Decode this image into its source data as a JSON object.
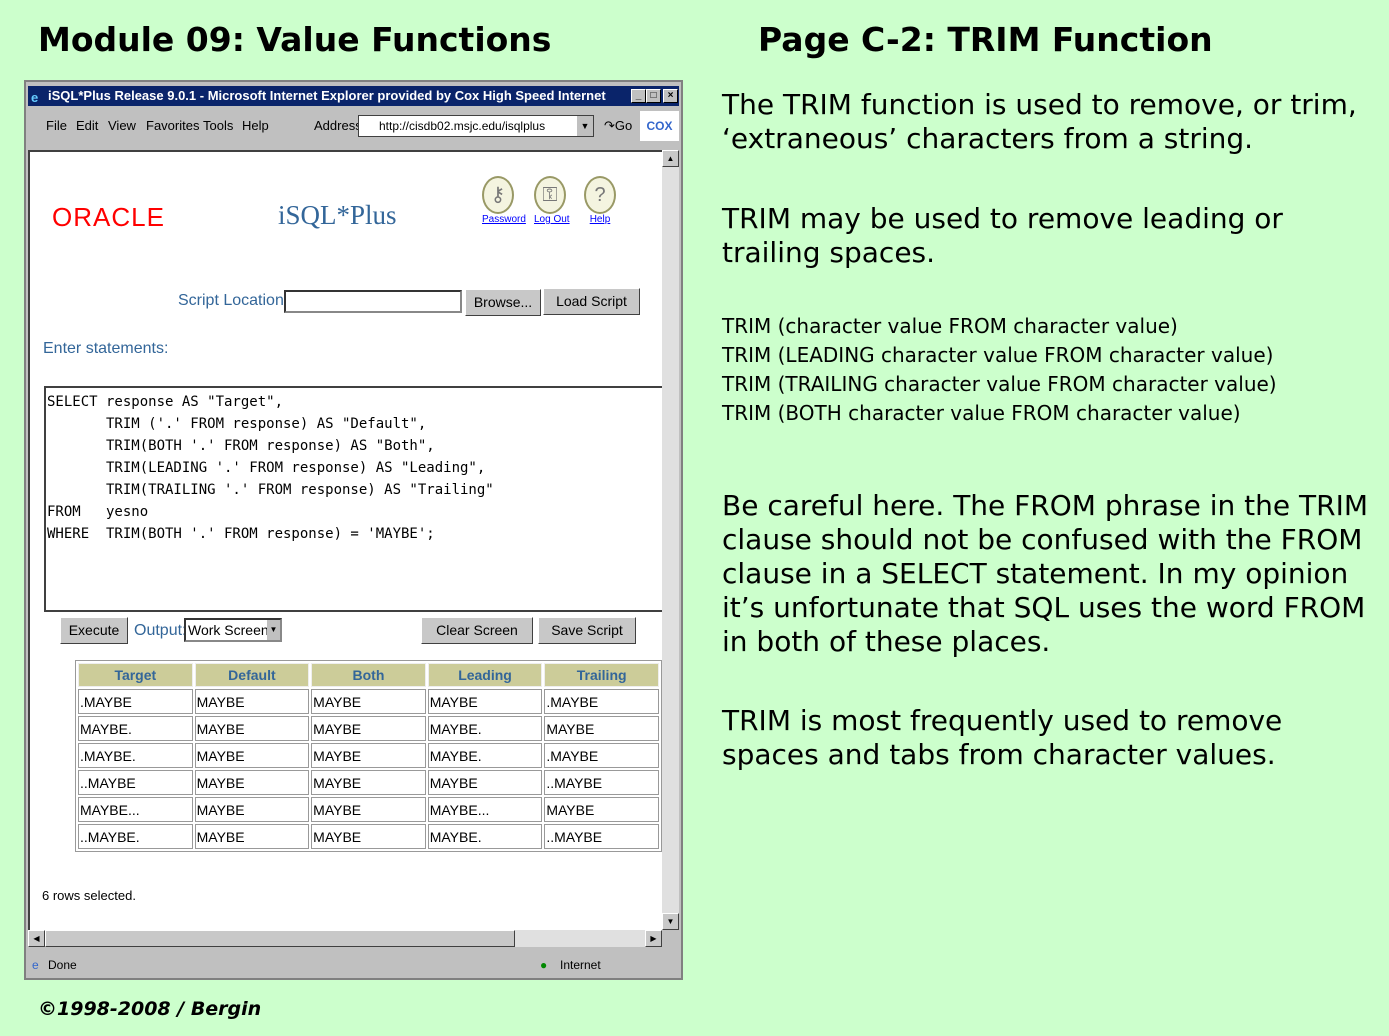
{
  "slide": {
    "left_title": "Module 09: Value Functions",
    "right_title": "Page C-2:  TRIM Function",
    "copyright": "©1998-2008 / Bergin",
    "paragraphs": [
      "The TRIM function is used to remove, or trim, ‘extraneous’ characters from a string.",
      "TRIM may be used to remove leading or trailing spaces.",
      "Be careful here.  The FROM phrase in the TRIM clause should not be confused with the FROM clause in a SELECT statement.  In my opinion it’s unfortunate that SQL uses the word FROM in both of these places.",
      "TRIM is most frequently used to remove spaces and tabs from character values."
    ],
    "syntax": [
      "TRIM (character value  FROM  character value)",
      "TRIM (LEADING character value  FROM  character value)",
      "TRIM (TRAILING character value  FROM  character value)",
      "TRIM (BOTH character value  FROM  character value)"
    ]
  },
  "browser": {
    "title": "iSQL*Plus Release 9.0.1 - Microsoft Internet Explorer provided by Cox High Speed Internet",
    "menu": [
      "File",
      "Edit",
      "View",
      "Favorites",
      "Tools",
      "Help"
    ],
    "address_label": "Address",
    "address": "http://cisdb02.msjc.edu/isqlplus",
    "go": "Go",
    "brand": "COX",
    "status": "Done",
    "zone": "Internet"
  },
  "app": {
    "logo": "ORACLE",
    "product": "iSQL*Plus",
    "links": [
      {
        "label": "Password",
        "icon": "password-icon"
      },
      {
        "label": "Log Out",
        "icon": "logout-icon"
      },
      {
        "label": "Help",
        "icon": "help-icon"
      }
    ],
    "script_location_label": "Script Location:",
    "script_location_value": "",
    "browse": "Browse...",
    "load_script": "Load Script",
    "enter_statements": "Enter statements:",
    "sql": "SELECT response AS \"Target\",\n       TRIM ('.' FROM response) AS \"Default\",\n       TRIM(BOTH '.' FROM response) AS \"Both\",\n       TRIM(LEADING '.' FROM response) AS \"Leading\",\n       TRIM(TRAILING '.' FROM response) AS \"Trailing\"\nFROM   yesno\nWHERE  TRIM(BOTH '.' FROM response) = 'MAYBE';",
    "execute": "Execute",
    "output_label": "Output:",
    "output_value": "Work Screen",
    "clear_screen": "Clear Screen",
    "save_script": "Save Script",
    "result": {
      "columns": [
        "Target",
        "Default",
        "Both",
        "Leading",
        "Trailing"
      ],
      "rows": [
        [
          ".MAYBE",
          "MAYBE",
          "MAYBE",
          "MAYBE",
          ".MAYBE"
        ],
        [
          "MAYBE.",
          "MAYBE",
          "MAYBE",
          "MAYBE.",
          "MAYBE"
        ],
        [
          ".MAYBE.",
          "MAYBE",
          "MAYBE",
          "MAYBE.",
          ".MAYBE"
        ],
        [
          "..MAYBE",
          "MAYBE",
          "MAYBE",
          "MAYBE",
          "..MAYBE"
        ],
        [
          "MAYBE...",
          "MAYBE",
          "MAYBE",
          "MAYBE...",
          "MAYBE"
        ],
        [
          "..MAYBE.",
          "MAYBE",
          "MAYBE",
          "MAYBE.",
          "..MAYBE"
        ]
      ]
    },
    "rows_selected": "6 rows selected."
  },
  "colors": {
    "background": "#ccffcc",
    "oracle_red": "#ff0000",
    "isql_blue": "#336699",
    "header_bg": "#cccc99",
    "titlebar": "#0a246a"
  }
}
